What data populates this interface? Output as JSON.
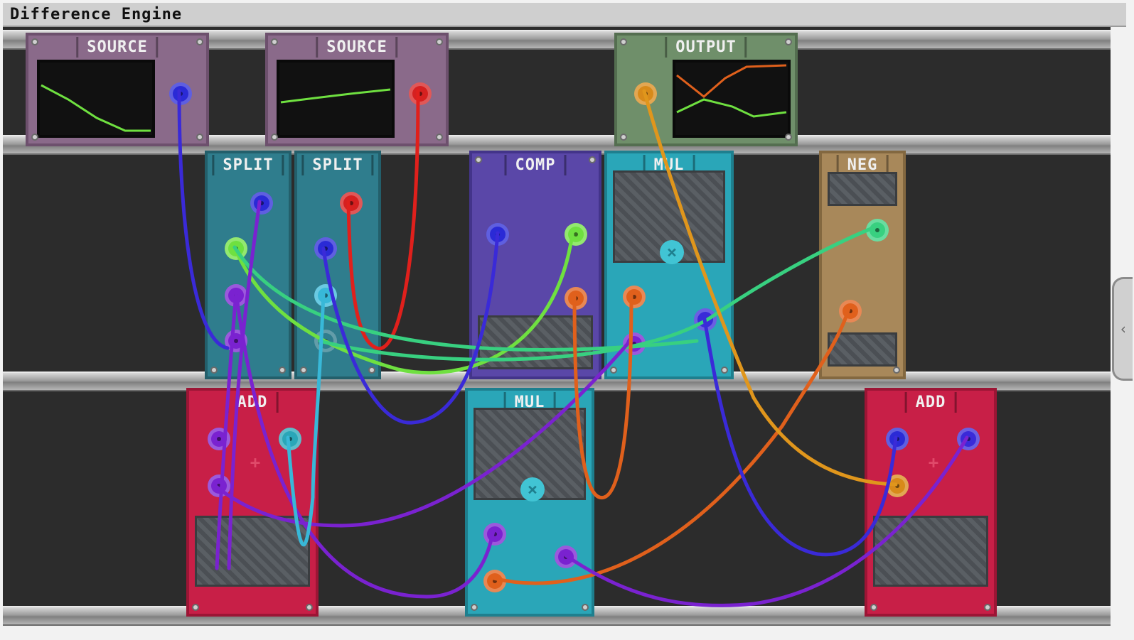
{
  "window": {
    "title": "Difference Engine"
  },
  "modules": {
    "source1": {
      "label": "SOURCE",
      "jack_color": "#2a2ad6"
    },
    "source2": {
      "label": "SOURCE",
      "jack_color": "#d62020"
    },
    "output": {
      "label": "OUTPUT",
      "jack_color": "#d88a1a"
    },
    "split1": {
      "label": "SPLIT"
    },
    "split2": {
      "label": "SPLIT"
    },
    "comp": {
      "label": "COMP"
    },
    "mul1": {
      "label": "MUL"
    },
    "neg": {
      "label": "NEG"
    },
    "add1": {
      "label": "ADD"
    },
    "mul2": {
      "label": "MUL"
    },
    "add2": {
      "label": "ADD"
    }
  },
  "colors": {
    "board": "#2c2c2c",
    "source_panel": "#8a6a8a",
    "output_panel": "#6f8f6a",
    "split_panel": "#2f7d8d",
    "comp_panel": "#5a47a8",
    "mul_panel": "#2aa6b8",
    "neg_panel": "#a8885a",
    "add_panel": "#c81f47",
    "wire_blue": "#3a2ad8",
    "wire_red": "#e0201c",
    "wire_green": "#6fe040",
    "wire_teal": "#38d080",
    "wire_purple": "#7a22d0",
    "wire_orange": "#e0601c",
    "wire_amber": "#e0961c",
    "wire_cyan": "#38b8d8"
  },
  "icons": {
    "side_handle": "chevron-left-icon",
    "mul_symbol": "times-icon",
    "add_symbol": "plus-icon"
  }
}
